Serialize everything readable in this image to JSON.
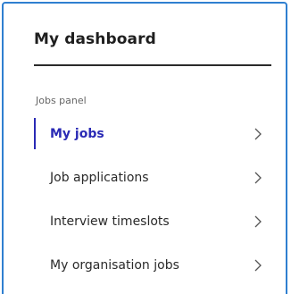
{
  "panel": {
    "title": "My dashboard",
    "section_label": "Jobs panel",
    "accent_color": "#2a2ab5",
    "border_color": "#2f7fd0",
    "items": [
      {
        "label": "My jobs",
        "active": true,
        "icon": "chevron-right-icon"
      },
      {
        "label": "Job applications",
        "active": false,
        "icon": "chevron-right-icon"
      },
      {
        "label": "Interview timeslots",
        "active": false,
        "icon": "chevron-right-icon"
      },
      {
        "label": "My organisation jobs",
        "active": false,
        "icon": "chevron-right-icon"
      }
    ]
  }
}
